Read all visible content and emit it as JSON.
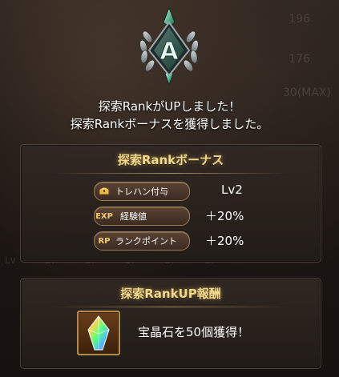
{
  "background": {
    "faint_numbers": [
      "196",
      "176",
      "30(MAX)"
    ],
    "faint_levels": [
      "Lv",
      "Lv",
      "Lv",
      "Lv",
      "Lv",
      "Lv"
    ]
  },
  "emblem": {
    "letter": "A",
    "icon": "rank-emblem-icon"
  },
  "message": {
    "line1": "探索RankがUPしました！",
    "line2": "探索Rankボーナスを獲得しました。"
  },
  "bonus_panel": {
    "title": "探索Rankボーナス",
    "rows": [
      {
        "icon_text": "",
        "icon": "treasure-chest-icon",
        "label": "トレハン付与",
        "value": "Lv2"
      },
      {
        "icon_text": "EXP",
        "icon": "exp-icon",
        "label": "経験値",
        "value": "＋20%"
      },
      {
        "icon_text": "RP",
        "icon": "rp-icon",
        "label": "ランクポイント",
        "value": "＋20%"
      }
    ]
  },
  "reward_panel": {
    "title": "探索RankUP報酬",
    "item_icon": "crystal-gem-icon",
    "text": "宝晶石を50個獲得！"
  },
  "colors": {
    "title_gold": "#f1d98f",
    "panel_border": "#4d4139",
    "pill_border": "#9c7c55"
  }
}
